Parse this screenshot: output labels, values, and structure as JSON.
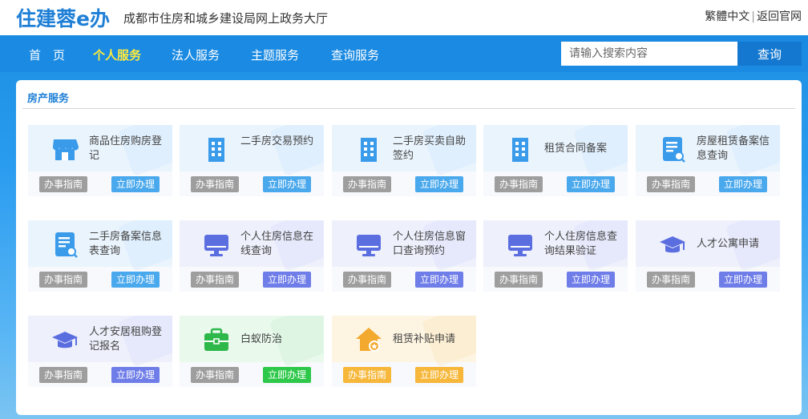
{
  "header": {
    "logo": "住建蓉e办",
    "site_title": "成都市住房和城乡建设局网上政务大厅",
    "lang_link": "繁體中文",
    "sep": "|",
    "home_link": "返回官网"
  },
  "nav": {
    "items": [
      {
        "label": "首　页",
        "active": false
      },
      {
        "label": "个人服务",
        "active": true
      },
      {
        "label": "法人服务",
        "active": false
      },
      {
        "label": "主题服务",
        "active": false
      },
      {
        "label": "查询服务",
        "active": false
      }
    ]
  },
  "search": {
    "placeholder": "请输入搜索内容",
    "button": "查询"
  },
  "section": {
    "title": "房产服务"
  },
  "colors": {
    "blue": "#4aa8ec",
    "indigo": "#6f7de8",
    "green": "#2ec84a",
    "yellow": "#f6b73a",
    "guide_gray": "#9e9e9e"
  },
  "cards": [
    {
      "label": "商品住房购房登记",
      "icon": "store-icon",
      "theme": "blue"
    },
    {
      "label": "二手房交易预约",
      "icon": "building-icon",
      "theme": "blue"
    },
    {
      "label": "二手房买卖自助签约",
      "icon": "building-icon",
      "theme": "blue"
    },
    {
      "label": "租赁合同备案",
      "icon": "building-icon",
      "theme": "blue"
    },
    {
      "label": "房屋租赁备案信息查询",
      "icon": "document-search-icon",
      "theme": "blue"
    },
    {
      "label": "二手房备案信息表查询",
      "icon": "document-search-icon",
      "theme": "blue"
    },
    {
      "label": "个人住房信息在线查询",
      "icon": "monitor-icon",
      "theme": "indigo"
    },
    {
      "label": "个人住房信息窗口查询预约",
      "icon": "monitor-icon",
      "theme": "indigo"
    },
    {
      "label": "个人住房信息查询结果验证",
      "icon": "monitor-icon",
      "theme": "indigo"
    },
    {
      "label": "人才公寓申请",
      "icon": "graduation-cap-icon",
      "theme": "indigo"
    },
    {
      "label": "人才安居租购登记报名",
      "icon": "graduation-cap-icon",
      "theme": "indigo"
    },
    {
      "label": "白蚁防治",
      "icon": "toolbox-icon",
      "theme": "green"
    },
    {
      "label": "租赁补贴申请",
      "icon": "house-coin-icon",
      "theme": "yellow"
    }
  ],
  "buttons": {
    "guide": "办事指南",
    "apply": "立即办理"
  }
}
